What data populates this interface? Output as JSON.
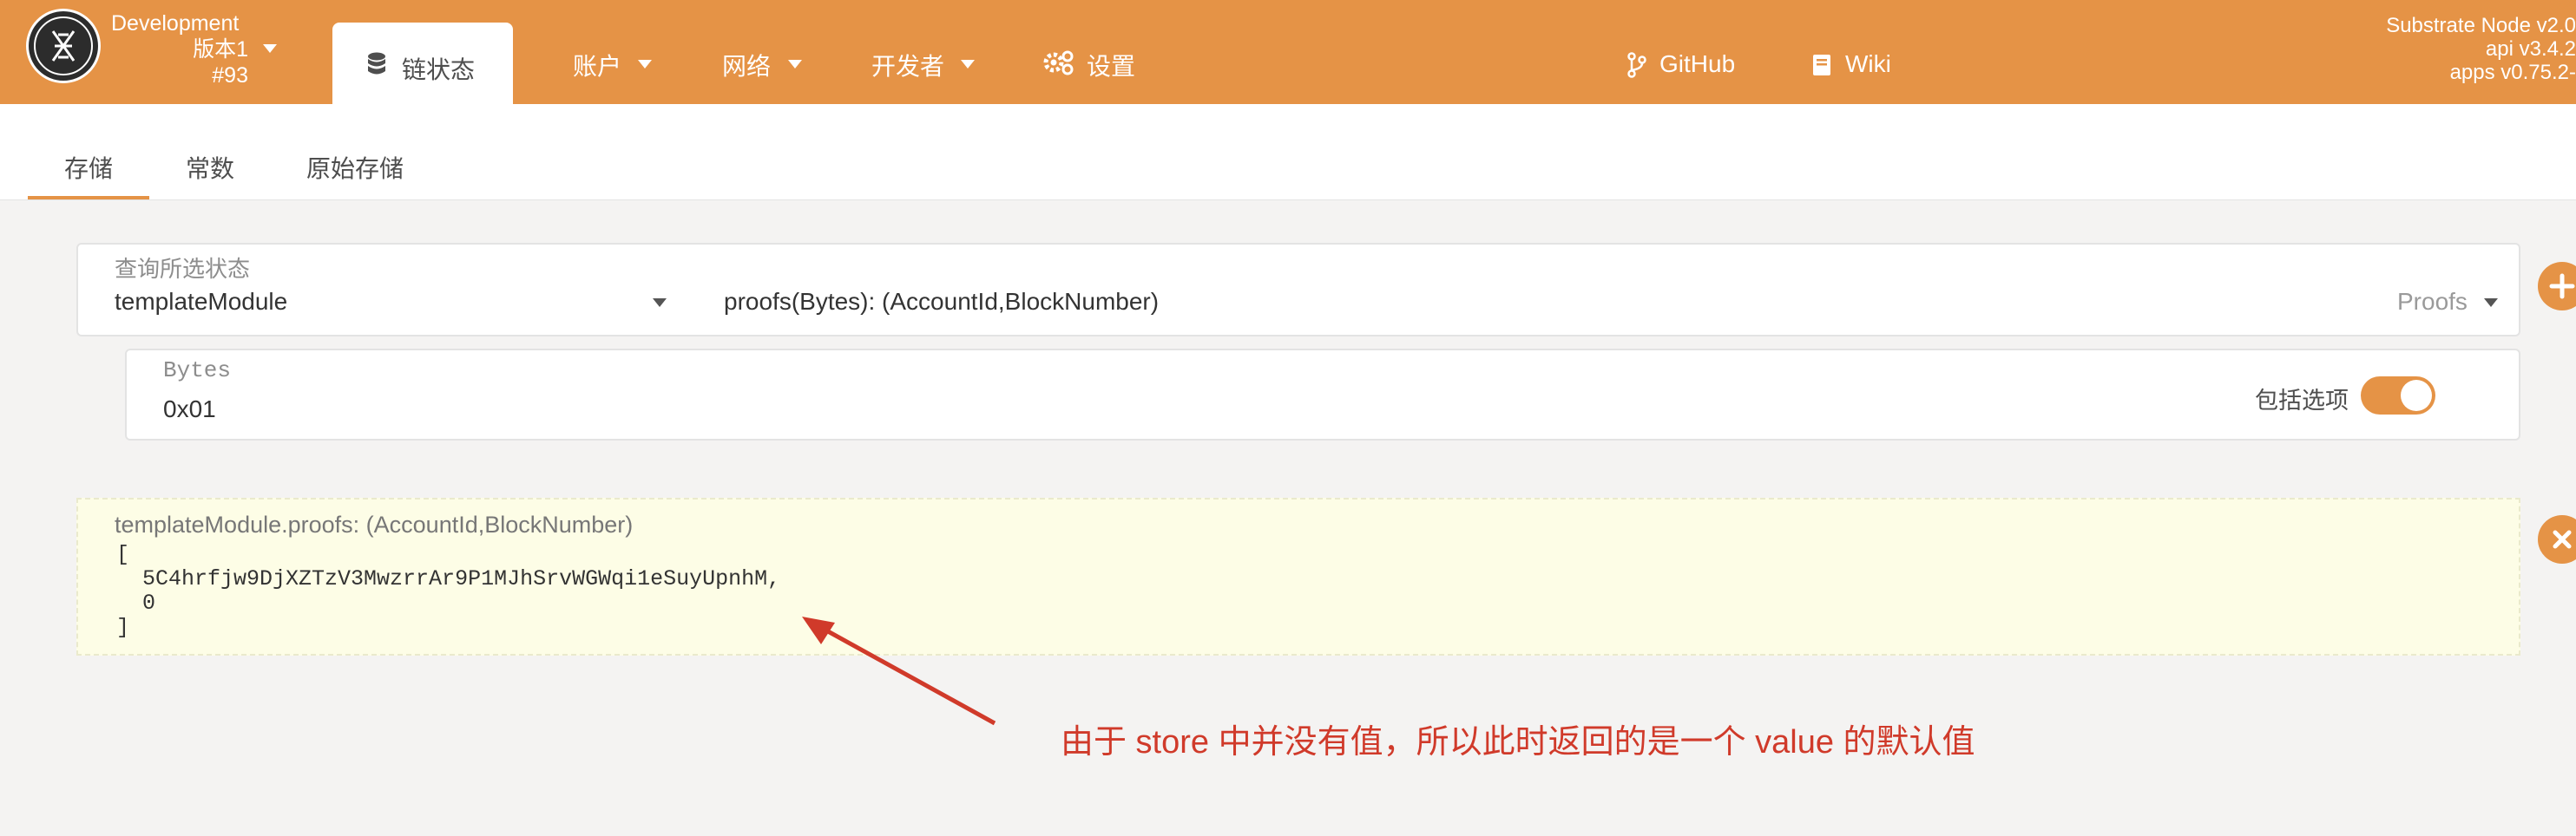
{
  "header": {
    "chain_name": "Development",
    "chain_version": "版本1",
    "block_number": "#93",
    "nav": {
      "active_label": "链状态",
      "accounts": "账户",
      "network": "网络",
      "developer": "开发者",
      "settings": "设置",
      "github": "GitHub",
      "wiki": "Wiki"
    },
    "node_info": {
      "name": "Substrate Node v2.0",
      "api": "api v3.4.2",
      "apps": "apps v0.75.2-"
    }
  },
  "subnav": {
    "tabs": [
      "存储",
      "常数",
      "原始存储"
    ],
    "active_index": 0
  },
  "query": {
    "label": "查询所选状态",
    "module": "templateModule",
    "method": "proofs(Bytes): (AccountId,BlockNumber)",
    "method_doc": "Proofs"
  },
  "param": {
    "label": "Bytes",
    "value": "0x01",
    "toggle_label": "包括选项",
    "toggle_on": true
  },
  "result": {
    "title": "templateModule.proofs: (AccountId,BlockNumber)",
    "lines": [
      "[",
      "  5C4hrfjw9DjXZTzV3MwzrrAr9P1MJhSrvWGWqi1eSuyUpnhM,",
      "  0",
      "]"
    ]
  },
  "annotation": {
    "text": "由于 store 中并没有值，所以此时返回的是一个 value 的默认值",
    "color": "#d03a2a"
  },
  "colors": {
    "brand": "#e59346",
    "result_bg": "#fdfde6",
    "page_bg": "#f4f3f2"
  }
}
